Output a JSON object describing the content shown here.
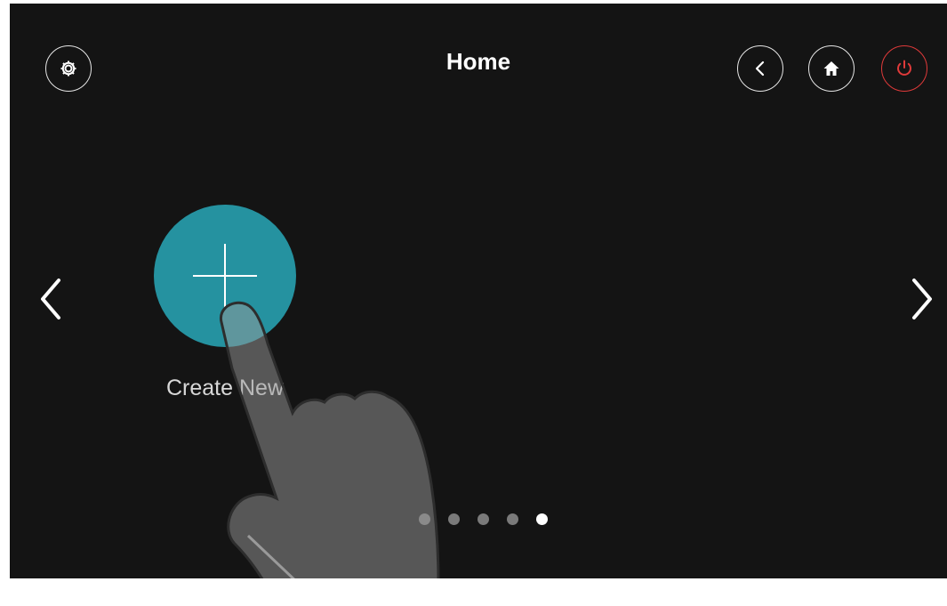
{
  "header": {
    "title": "Home",
    "settings_icon": "gear-icon",
    "back_icon": "chevron-left-icon",
    "home_icon": "house-icon",
    "power_icon": "power-icon"
  },
  "main": {
    "create_new": {
      "label": "Create New",
      "icon": "plus-icon"
    },
    "prev_icon": "chevron-left-icon",
    "next_icon": "chevron-right-icon"
  },
  "pager": {
    "page_count": 5,
    "active_page": 5
  },
  "overlay": {
    "icon": "pointing-hand-icon"
  },
  "colors": {
    "background": "#141414",
    "accent": "#2592a0",
    "power": "#e03a3a",
    "text": "#ffffff"
  }
}
